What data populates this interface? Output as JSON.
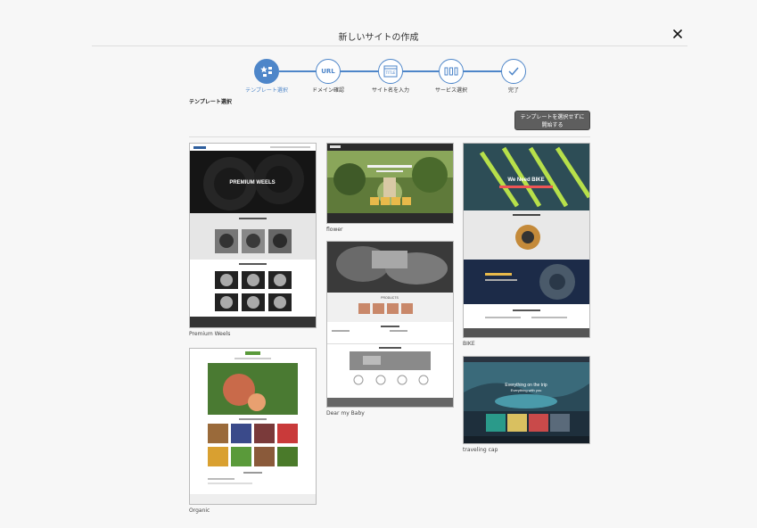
{
  "dialog": {
    "title": "新しいサイトの作成"
  },
  "steps": [
    {
      "label": "テンプレート選択",
      "active": true,
      "icon": "star-grid-icon"
    },
    {
      "label": "ドメイン確認",
      "active": false,
      "icon_text": "URL"
    },
    {
      "label": "サイト名を入力",
      "active": false,
      "icon_text": "TITLE"
    },
    {
      "label": "サービス選択",
      "active": false,
      "icon": "service-blocks-icon"
    },
    {
      "label": "完了",
      "active": false,
      "icon": "check-icon"
    }
  ],
  "section": {
    "label": "テンプレート選択",
    "skip_button_line1": "テンプレートを選択せずに",
    "skip_button_line2": "開始する"
  },
  "templates": [
    {
      "name": "Premium Weels",
      "hero_text": "PREMIUM WEELS"
    },
    {
      "name": "flower"
    },
    {
      "name": "BIKE",
      "hero_text": "We Need BIKE"
    },
    {
      "name": "Dear my Baby",
      "section_text": "PRODUCTS"
    },
    {
      "name": "Organic"
    },
    {
      "name": "traveling cap",
      "hero_text": "Everything on the trip",
      "hero_sub": "Everything with you"
    }
  ],
  "colors": {
    "accent": "#4e86c9",
    "button": "#5e5e5e"
  }
}
